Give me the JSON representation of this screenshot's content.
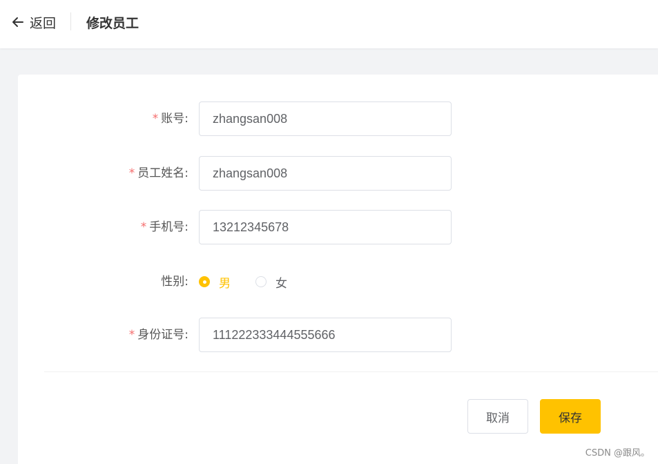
{
  "header": {
    "back_label": "返回",
    "title": "修改员工"
  },
  "form": {
    "account": {
      "label": "账号:",
      "required": "*",
      "value": "zhangsan008"
    },
    "name": {
      "label": "员工姓名:",
      "required": "*",
      "value": "zhangsan008"
    },
    "phone": {
      "label": "手机号:",
      "required": "*",
      "value": "13212345678"
    },
    "gender": {
      "label": "性别:",
      "options": [
        {
          "label": "男",
          "checked": true
        },
        {
          "label": "女",
          "checked": false
        }
      ]
    },
    "id_card": {
      "label": "身份证号:",
      "required": "*",
      "value": "111222333444555666"
    }
  },
  "actions": {
    "cancel_label": "取消",
    "save_label": "保存"
  },
  "watermark": "CSDN @跟风。",
  "colors": {
    "accent": "#ffc200",
    "required": "#f56c6c",
    "page_bg": "#f2f3f5"
  },
  "icons": {
    "back": "arrow-left-icon"
  }
}
